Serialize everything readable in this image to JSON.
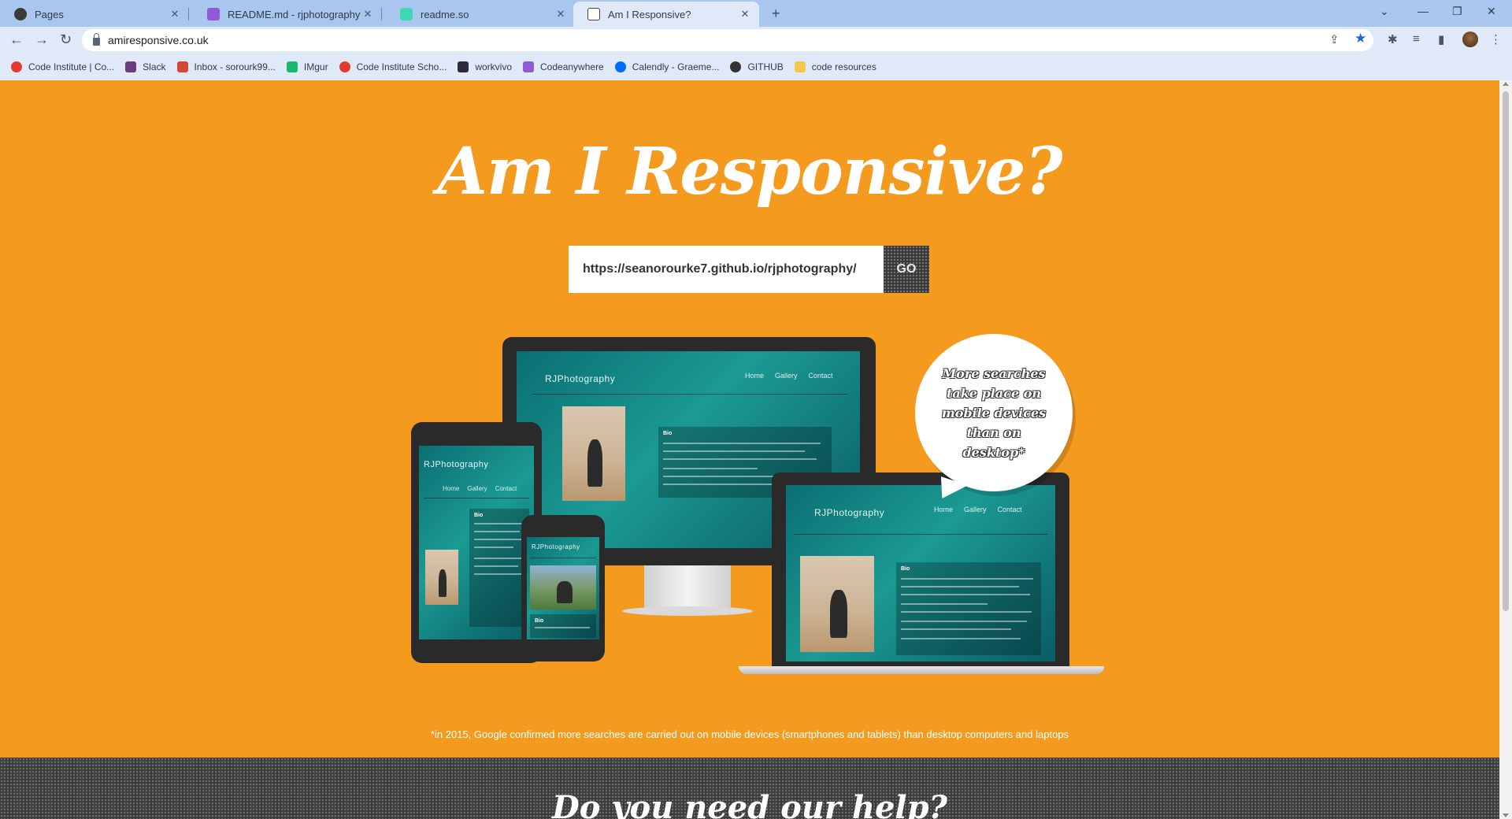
{
  "browser": {
    "tabs": [
      {
        "title": "Pages",
        "favicon_color": "#3a3a3a"
      },
      {
        "title": "README.md - rjphotography - C",
        "favicon_color": "#8e5bd3"
      },
      {
        "title": "readme.so",
        "favicon_color": "#3ed6b6"
      },
      {
        "title": "Am I Responsive?",
        "favicon_color": "#ffffff",
        "active": true
      }
    ],
    "new_tab": "+",
    "window_controls": {
      "dropdown": "⌄",
      "minimize": "—",
      "restore": "❐",
      "close": "✕"
    },
    "nav": {
      "back": "←",
      "forward": "→",
      "reload": "↻"
    },
    "url": "amiresponsive.co.uk",
    "toolbar_icons": {
      "share": "⇪",
      "star": "★",
      "extensions": "✱",
      "media": "≡",
      "sidebar": "▮",
      "menu": "⋮"
    },
    "bookmarks": [
      {
        "label": "Code Institute | Co...",
        "color": "#e23b2e"
      },
      {
        "label": "Slack",
        "color": "#6e3c7c"
      },
      {
        "label": "Inbox - sorourk99...",
        "color": "#d44638"
      },
      {
        "label": "IMgur",
        "color": "#1bb76e"
      },
      {
        "label": "Code Institute Scho...",
        "color": "#e23b2e"
      },
      {
        "label": "workvivo",
        "color": "#2b2b3a"
      },
      {
        "label": "Codeanywhere",
        "color": "#8e5bd3"
      },
      {
        "label": "Calendly - Graeme...",
        "color": "#006bff"
      },
      {
        "label": "GITHUB",
        "color": "#333333"
      },
      {
        "label": "code resources",
        "color": "#f2c94c"
      }
    ]
  },
  "page": {
    "title": "Am I Responsive?",
    "url_input_value": "https://seanorourke7.github.io/rjphotography/",
    "go_label": "GO",
    "bubble_text": "More searches take place on mobile devices than on desktop*",
    "footnote": "*in 2015, Google confirmed more searches are carried out on mobile devices (smartphones and tablets) than desktop computers and laptops",
    "help_title": "Do you need our help?"
  },
  "preview_site": {
    "brand": "RJPhotography",
    "menu": [
      "Home",
      "Gallery",
      "Contact"
    ],
    "bio_heading": "Bio"
  },
  "colors": {
    "accent_orange": "#f49a1f",
    "site_teal": "#1b9a93"
  }
}
